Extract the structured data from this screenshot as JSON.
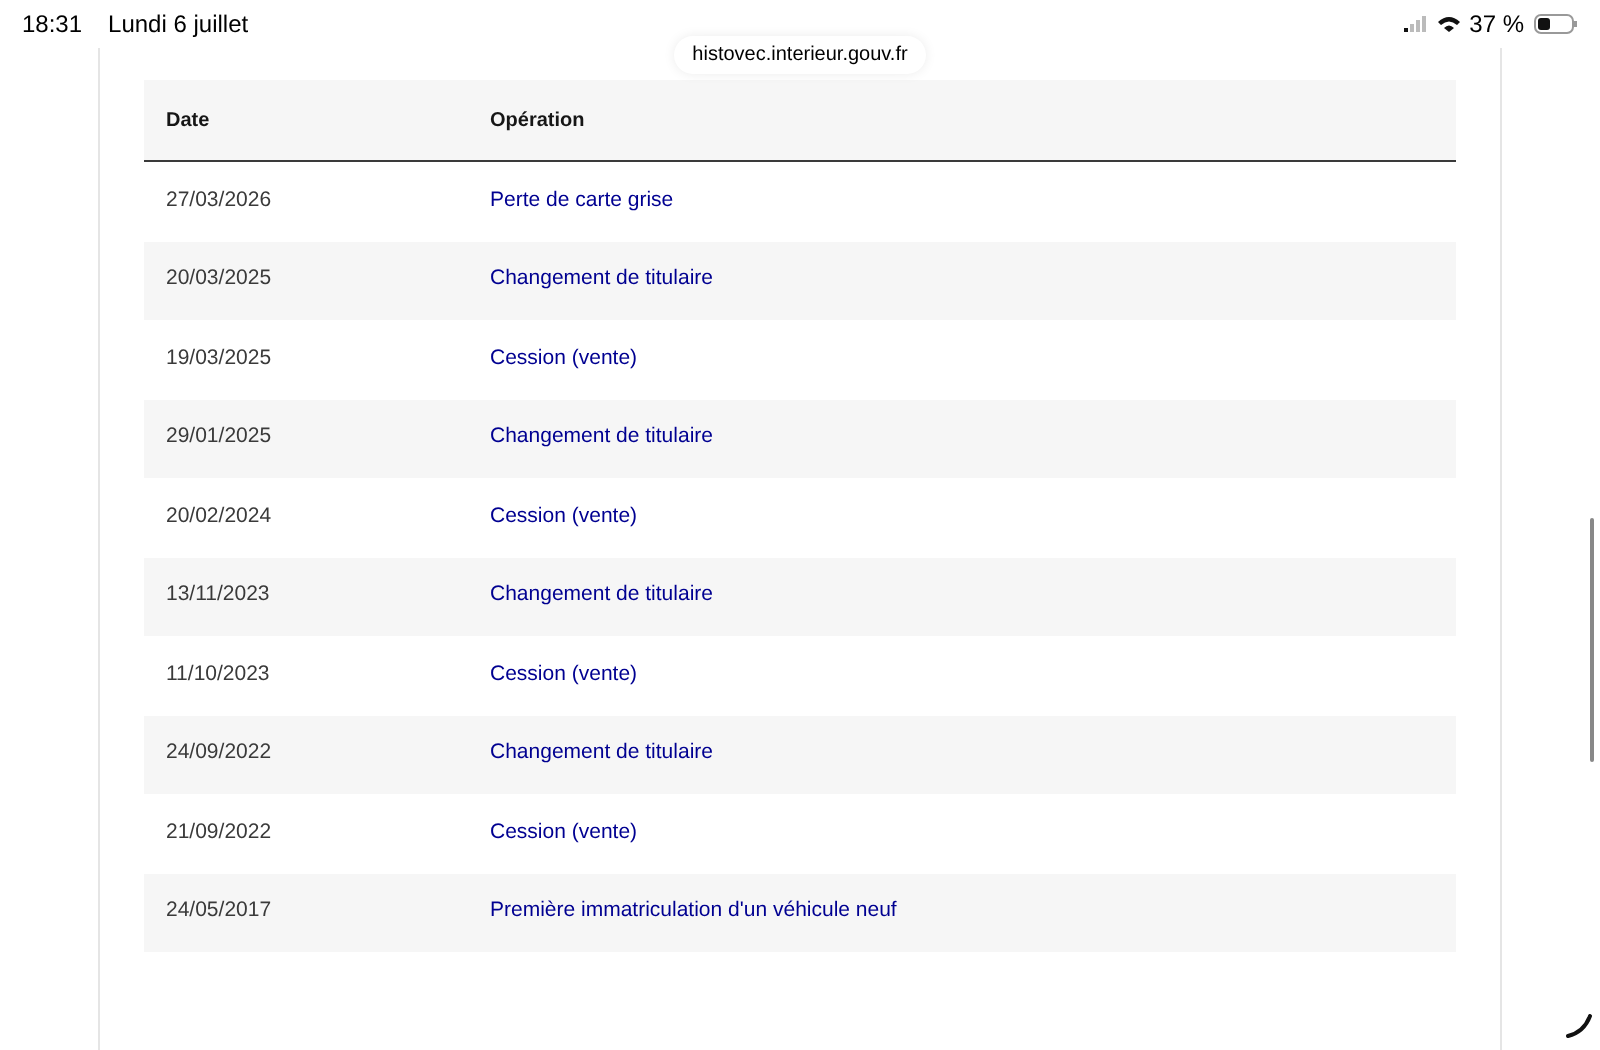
{
  "status_bar": {
    "time": "18:31",
    "date": "Lundi 6 juillet",
    "battery": "37 %"
  },
  "url_bar": {
    "url": "histovec.interieur.gouv.fr"
  },
  "table": {
    "columns": [
      "Date",
      "Opération"
    ],
    "rows": [
      {
        "date": "27/03/2026",
        "operation": "Perte de carte grise"
      },
      {
        "date": "20/03/2025",
        "operation": "Changement de titulaire"
      },
      {
        "date": "19/03/2025",
        "operation": "Cession (vente)"
      },
      {
        "date": "29/01/2025",
        "operation": "Changement de titulaire"
      },
      {
        "date": "20/02/2024",
        "operation": "Cession (vente)"
      },
      {
        "date": "13/11/2023",
        "operation": "Changement de titulaire"
      },
      {
        "date": "11/10/2023",
        "operation": "Cession (vente)"
      },
      {
        "date": "24/09/2022",
        "operation": "Changement de titulaire"
      },
      {
        "date": "21/09/2022",
        "operation": "Cession (vente)"
      },
      {
        "date": "24/05/2017",
        "operation": "Première immatriculation d'un véhicule neuf"
      }
    ]
  }
}
